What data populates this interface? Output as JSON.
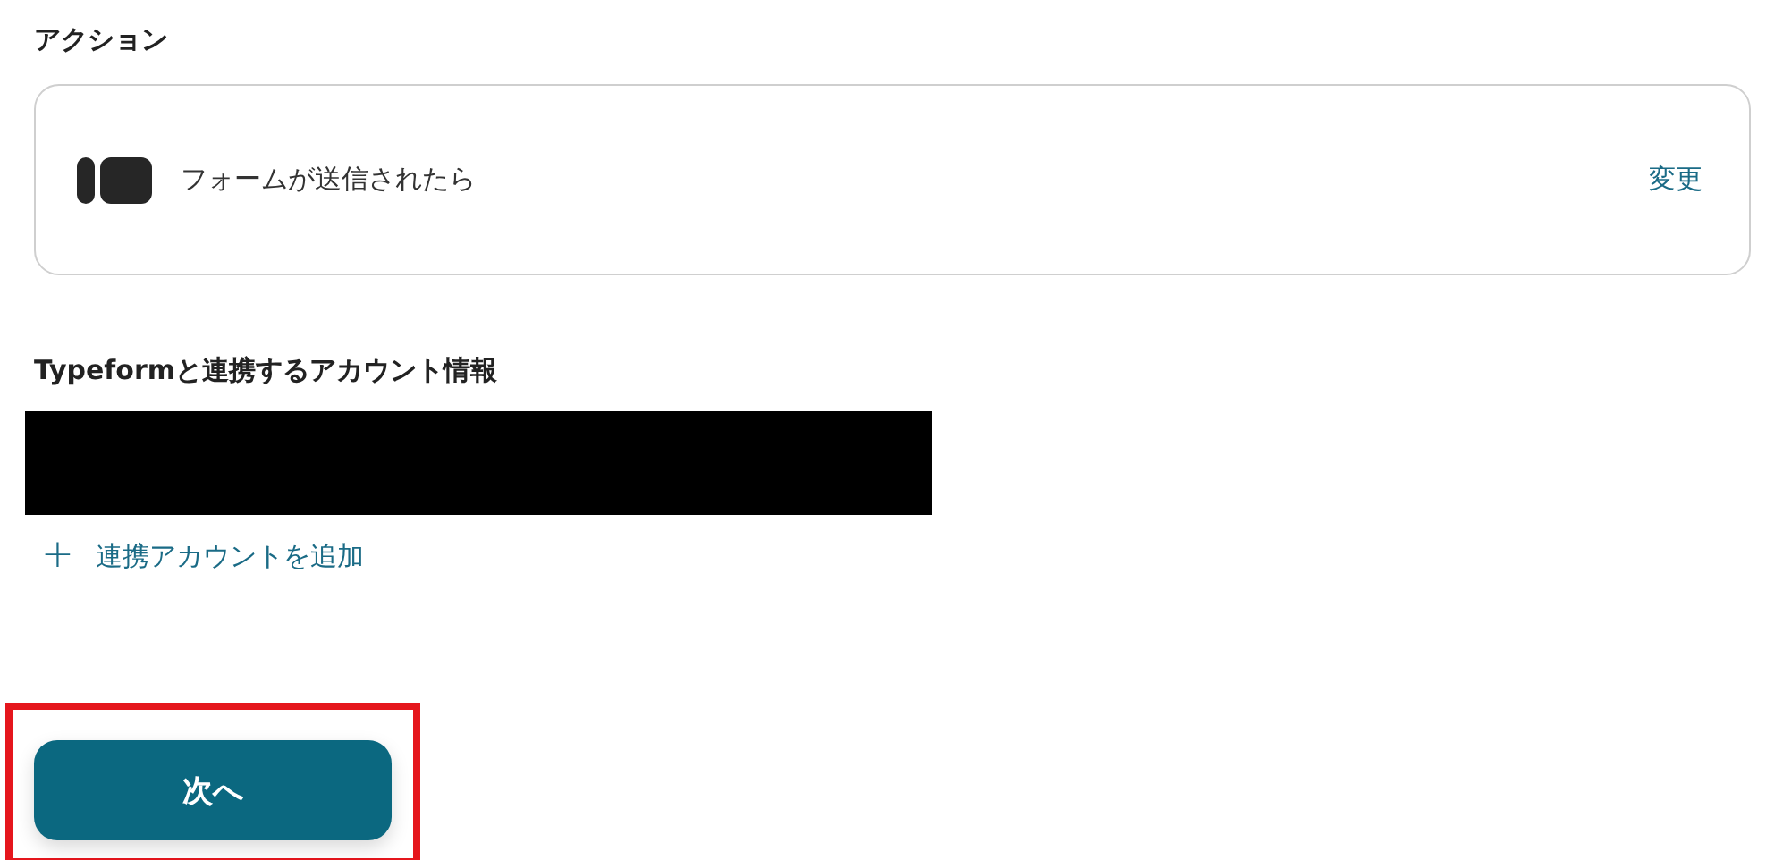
{
  "action": {
    "heading": "アクション",
    "trigger": "フォームが送信されたら",
    "change_link": "変更"
  },
  "account": {
    "heading": "Typeformと連携するアカウント情報",
    "redacted": true,
    "add_link": {
      "icon": "+",
      "label": "連携アカウントを追加"
    }
  },
  "next_button": {
    "label": "次へ",
    "highlighted": true
  }
}
